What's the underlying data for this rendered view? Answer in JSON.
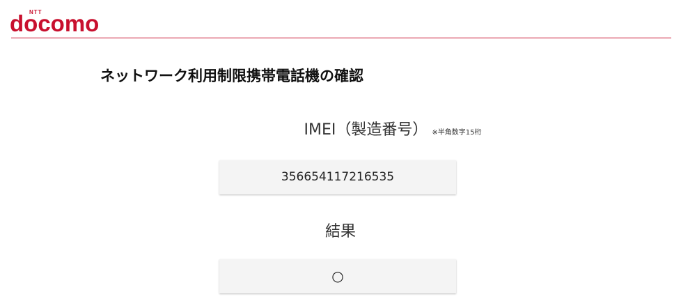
{
  "header": {
    "logo_small": "NTT",
    "logo_word": "docomo",
    "brand_color": "#c8102e"
  },
  "main": {
    "title": "ネットワーク利用制限携帯電話機の確認",
    "imei": {
      "label": "IMEI（製造番号）",
      "note": "※半角数字15桁",
      "value": "356654117216535"
    },
    "result": {
      "label": "結果",
      "value": "○"
    }
  }
}
